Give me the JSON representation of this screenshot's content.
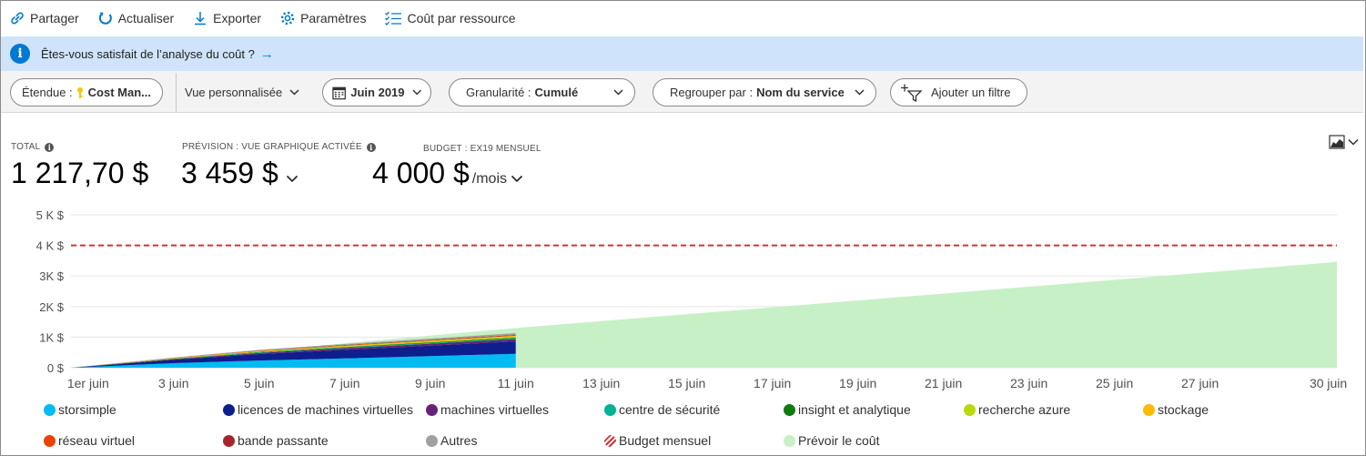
{
  "toolbar": {
    "share": "Partager",
    "refresh": "Actualiser",
    "export": "Exporter",
    "settings": "Paramètres",
    "cost_by_resource": "Coût par ressource"
  },
  "banner": {
    "text": "Êtes-vous satisfait de l’analyse du coût ?"
  },
  "filters": {
    "scope_label": "Étendue :",
    "scope_value": "Cost Man...",
    "view": "Vue personnalisée",
    "date": "Juin 2019",
    "granularity_label": "Granularité :",
    "granularity_value": "Cumulé",
    "group_label": "Regrouper par :",
    "group_value": "Nom du service",
    "add_filter": "Ajouter un filtre"
  },
  "kpis": {
    "total_label": "TOTAL",
    "total_value": "1 217,70 $",
    "forecast_label": "PRÉVISION : VUE GRAPHIQUE ACTIVÉE",
    "forecast_value": "3 459 $",
    "budget_label": "BUDGET : EX19 MENSUEL",
    "budget_value": "4 000 $",
    "budget_unit": "/mois"
  },
  "chart_data": {
    "type": "area",
    "x_ticks": [
      {
        "day": 1,
        "label": "1er juin"
      },
      {
        "day": 3,
        "label": "3 juin"
      },
      {
        "day": 5,
        "label": "5 juin"
      },
      {
        "day": 7,
        "label": "7 juin"
      },
      {
        "day": 9,
        "label": "9 juin"
      },
      {
        "day": 11,
        "label": "11 juin"
      },
      {
        "day": 13,
        "label": "13 juin"
      },
      {
        "day": 15,
        "label": "15 juin"
      },
      {
        "day": 17,
        "label": "17 juin"
      },
      {
        "day": 19,
        "label": "19 juin"
      },
      {
        "day": 21,
        "label": "21 juin"
      },
      {
        "day": 23,
        "label": "23 juin"
      },
      {
        "day": 25,
        "label": "25 juin"
      },
      {
        "day": 27,
        "label": "27 juin"
      },
      {
        "day": 30,
        "label": "30 juin"
      }
    ],
    "y_ticks": [
      {
        "value": 0,
        "label": "0 $"
      },
      {
        "value": 1000,
        "label": "1K $"
      },
      {
        "value": 2000,
        "label": "2K $"
      },
      {
        "value": 3000,
        "label": "3K $"
      },
      {
        "value": 4000,
        "label": "4 K $"
      },
      {
        "value": 5000,
        "label": "5 K $"
      }
    ],
    "ylim": [
      0,
      5000
    ],
    "xlim": [
      0.6,
      30.2
    ],
    "budget": 4000,
    "series": [
      {
        "name": "storsimple",
        "color": "#00bcf2",
        "points": [
          [
            0.6,
            0
          ],
          [
            3,
            150
          ],
          [
            5,
            235
          ],
          [
            7,
            305
          ],
          [
            9,
            380
          ],
          [
            11,
            455
          ]
        ]
      },
      {
        "name": "licences de machines virtuelles",
        "color": "#0e1e8c",
        "points": [
          [
            0.6,
            0
          ],
          [
            3,
            110
          ],
          [
            5,
            210
          ],
          [
            7,
            280
          ],
          [
            9,
            340
          ],
          [
            11,
            405
          ]
        ]
      },
      {
        "name": "machines virtuelles",
        "color": "#68217a",
        "points": [
          [
            0.6,
            0
          ],
          [
            3,
            20
          ],
          [
            5,
            40
          ],
          [
            7,
            55
          ],
          [
            9,
            65
          ],
          [
            11,
            75
          ]
        ]
      },
      {
        "name": "centre de sécurité",
        "color": "#00b294",
        "points": [
          [
            0.6,
            0
          ],
          [
            3,
            8
          ],
          [
            5,
            14
          ],
          [
            7,
            18
          ],
          [
            9,
            22
          ],
          [
            11,
            25
          ]
        ]
      },
      {
        "name": "insight et analytique",
        "color": "#107c10",
        "points": [
          [
            0.6,
            0
          ],
          [
            3,
            8
          ],
          [
            5,
            14
          ],
          [
            7,
            18
          ],
          [
            9,
            22
          ],
          [
            11,
            25
          ]
        ]
      },
      {
        "name": "recherche azure",
        "color": "#bad80a",
        "points": [
          [
            0.6,
            0
          ],
          [
            3,
            10
          ],
          [
            5,
            18
          ],
          [
            7,
            25
          ],
          [
            9,
            30
          ],
          [
            11,
            35
          ]
        ]
      },
      {
        "name": "stockage",
        "color": "#ffb900",
        "points": [
          [
            0.6,
            0
          ],
          [
            3,
            8
          ],
          [
            5,
            14
          ],
          [
            7,
            18
          ],
          [
            9,
            22
          ],
          [
            11,
            25
          ]
        ]
      },
      {
        "name": "réseau virtuel",
        "color": "#ea4300",
        "points": [
          [
            0.6,
            0
          ],
          [
            3,
            5
          ],
          [
            5,
            9
          ],
          [
            7,
            12
          ],
          [
            9,
            14
          ],
          [
            11,
            16
          ]
        ]
      },
      {
        "name": "bande passante",
        "color": "#a4262c",
        "points": [
          [
            0.6,
            0
          ],
          [
            3,
            5
          ],
          [
            5,
            9
          ],
          [
            7,
            12
          ],
          [
            9,
            14
          ],
          [
            11,
            16
          ]
        ]
      },
      {
        "name": "Autres",
        "color": "#a0a0a0",
        "points": [
          [
            0.6,
            0
          ],
          [
            3,
            10
          ],
          [
            5,
            22
          ],
          [
            7,
            32
          ],
          [
            9,
            42
          ],
          [
            11,
            53
          ]
        ]
      }
    ],
    "forecast": {
      "name": "Prévoir le coût",
      "color": "#c7f0c7",
      "points": [
        [
          0.6,
          0
        ],
        [
          11,
          1300
        ],
        [
          30.2,
          3459
        ]
      ]
    },
    "legend": [
      {
        "name": "storsimple",
        "color": "#00bcf2"
      },
      {
        "name": "licences de machines virtuelles",
        "color": "#0e1e8c"
      },
      {
        "name": "machines virtuelles",
        "color": "#68217a"
      },
      {
        "name": "centre de sécurité",
        "color": "#00b294"
      },
      {
        "name": "insight et analytique",
        "color": "#107c10"
      },
      {
        "name": "recherche azure",
        "color": "#bad80a"
      },
      {
        "name": "stockage",
        "color": "#ffb900"
      },
      {
        "name": "réseau virtuel",
        "color": "#ea4300"
      },
      {
        "name": "bande passante",
        "color": "#a4262c"
      },
      {
        "name": "Autres",
        "color": "#a0a0a0"
      },
      {
        "name": "Budget mensuel",
        "color": "#d13438",
        "hatched": true
      },
      {
        "name": "Prévoir le coût",
        "color": "#c7f0c7"
      }
    ]
  },
  "colors": {
    "accent": "#0078d4",
    "banner_bg": "#cfe4fa",
    "budget_line": "#d13438"
  }
}
